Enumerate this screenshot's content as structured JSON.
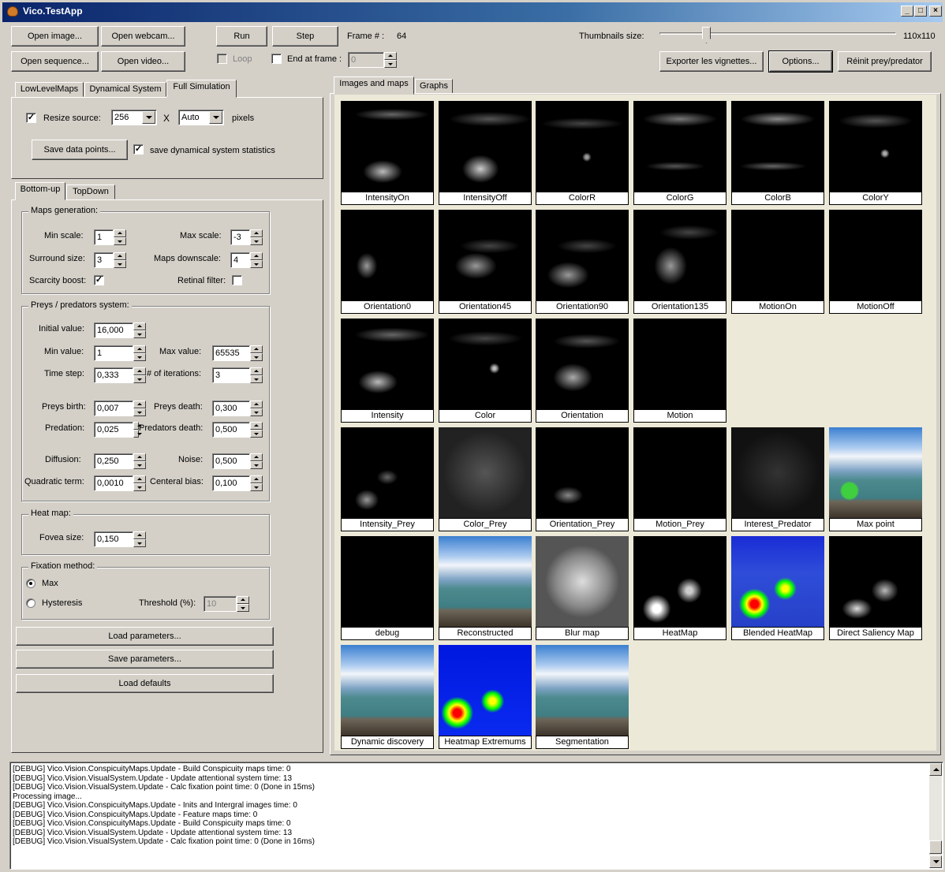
{
  "window": {
    "title": "Vico.TestApp"
  },
  "toolbar": {
    "open_image": "Open image...",
    "open_webcam": "Open webcam...",
    "open_sequence": "Open sequence...",
    "open_video": "Open video...",
    "run": "Run",
    "step": "Step",
    "frame_label": "Frame # :",
    "frame_value": "64",
    "loop_label": "Loop",
    "end_at_frame_label": "End at frame :",
    "end_at_frame_value": "0",
    "thumbnails_label": "Thumbnails size:",
    "thumbnails_value": "110x110",
    "thumbnails_slider_fraction": 0.19,
    "export_button": "Exporter les vignettes...",
    "options_button": "Options...",
    "reset_button": "Réinit prey/predator"
  },
  "main_tabs": [
    "LowLevelMaps",
    "Dynamical System",
    "Full Simulation"
  ],
  "full_sim": {
    "resize_label": "Resize source:",
    "resize_w": "256",
    "times": "X",
    "resize_h": "Auto",
    "pixels": "pixels",
    "save_points": "Save data points...",
    "save_stats_label": "save dynamical system statistics"
  },
  "sub_tabs": [
    "Bottom-up",
    "TopDown"
  ],
  "maps_gen": {
    "legend": "Maps generation:",
    "min_scale_label": "Min scale:",
    "min_scale": "1",
    "max_scale_label": "Max scale:",
    "max_scale": "-3",
    "surround_label": "Surround size:",
    "surround": "3",
    "downscale_label": "Maps downscale:",
    "downscale": "4",
    "scarcity_label": "Scarcity boost:",
    "retinal_label": "Retinal filter:"
  },
  "preys": {
    "legend": "Preys / predators system:",
    "initial_label": "Initial value:",
    "initial": "16,000",
    "min_label": "Min value:",
    "min": "1",
    "max_label": "Max value:",
    "max": "65535",
    "timestep_label": "Time step:",
    "timestep": "0,333",
    "iterations_label": "# of iterations:",
    "iterations": "3",
    "birth_label": "Preys birth:",
    "birth": "0,007",
    "death_label": "Preys death:",
    "death": "0,300",
    "predation_label": "Predation:",
    "predation": "0,025",
    "pred_death_label": "Predators death:",
    "pred_death": "0,500",
    "diffusion_label": "Diffusion:",
    "diffusion": "0,250",
    "noise_label": "Noise:",
    "noise": "0,500",
    "quadratic_label": "Quadratic term:",
    "quadratic": "0,0010",
    "central_label": "Centeral bias:",
    "central": "0,100"
  },
  "heat": {
    "legend": "Heat map:",
    "fovea_label": "Fovea size:",
    "fovea": "0,150"
  },
  "fixation": {
    "legend": "Fixation method:",
    "max_label": "Max",
    "hysteresis_label": "Hysteresis",
    "threshold_label": "Threshold (%):",
    "threshold": "10"
  },
  "param_buttons": {
    "load": "Load parameters...",
    "save": "Save parameters...",
    "defaults": "Load defaults"
  },
  "right_tabs": [
    "Images and maps",
    "Graphs"
  ],
  "thumbnails": [
    "IntensityOn",
    "IntensityOff",
    "ColorR",
    "ColorG",
    "ColorB",
    "ColorY",
    "Orientation0",
    "Orientation45",
    "Orientation90",
    "Orientation135",
    "MotionOn",
    "MotionOff",
    "Intensity",
    "Color",
    "Orientation",
    "Motion",
    "Intensity_Prey",
    "Color_Prey",
    "Orientation_Prey",
    "Motion_Prey",
    "Interest_Predator",
    "Max point",
    "debug",
    "Reconstructed",
    "Blur map",
    "HeatMap",
    "Blended HeatMap",
    "Direct Saliency Map",
    "Dynamic discovery",
    "Heatmap Extremums",
    "Segmentation"
  ],
  "log": [
    "[DEBUG] Vico.Vision.ConspicuityMaps.Update - Build Conspicuity maps time: 0",
    "[DEBUG] Vico.Vision.VisualSystem.Update - Update attentional system time: 13",
    "[DEBUG] Vico.Vision.VisualSystem.Update - Calc fixation point time: 0  (Done in 15ms)",
    "Processing image...",
    "[DEBUG] Vico.Vision.ConspicuityMaps.Update - Inits and Intergral images time: 0",
    "[DEBUG] Vico.Vision.ConspicuityMaps.Update - Feature maps time: 0",
    "[DEBUG] Vico.Vision.ConspicuityMaps.Update - Build Conspicuity maps time: 0",
    "[DEBUG] Vico.Vision.VisualSystem.Update - Update attentional system time: 13",
    "[DEBUG] Vico.Vision.VisualSystem.Update - Calc fixation point time: 0  (Done in 16ms)"
  ]
}
